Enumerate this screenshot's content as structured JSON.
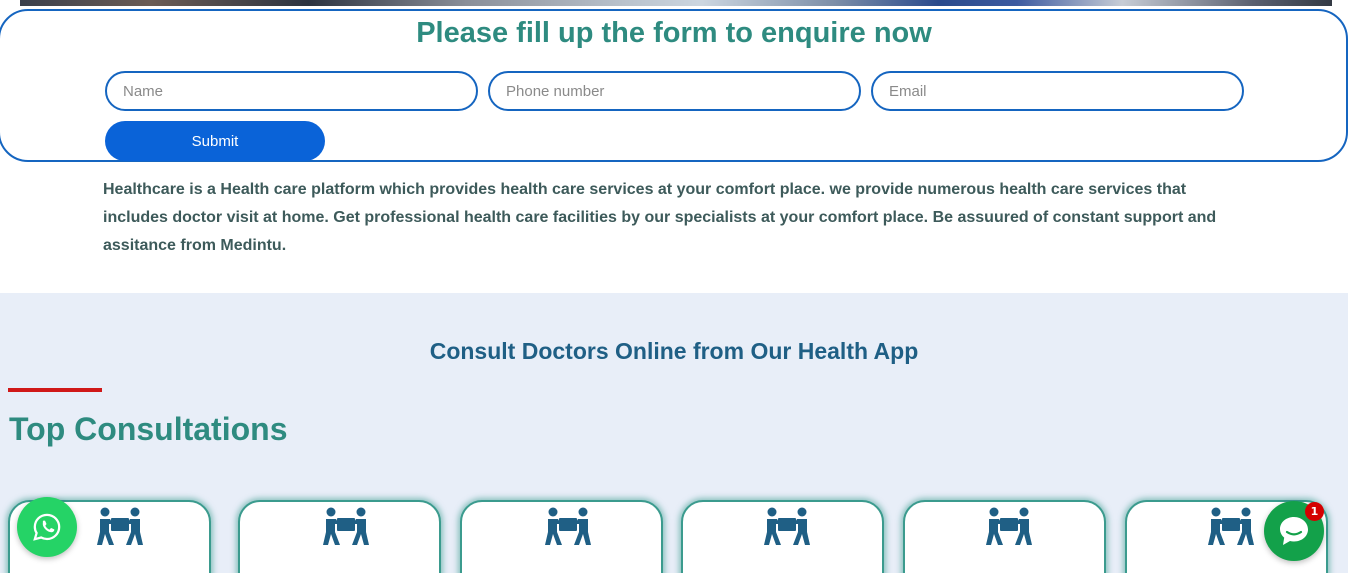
{
  "enquiry": {
    "title": "Please fill up the form to enquire now",
    "name_placeholder": "Name",
    "phone_placeholder": "Phone number",
    "email_placeholder": "Email",
    "submit_label": "Submit"
  },
  "about": {
    "text": "Healthcare is a Health care platform which provides health care services at your comfort place. we provide numerous health care services that  includes doctor visit at home. Get professional health care facilities by our specialists at your comfort place. Be assuured of constant support and assitance from Medintu."
  },
  "consult": {
    "heading": "Consult Doctors Online from Our Health App",
    "section_title": "Top Consultations",
    "card_icon": "people-carrying-box-icon",
    "card_count": 6
  },
  "widgets": {
    "whatsapp_icon": "whatsapp-icon",
    "chat_icon": "chat-bubble-icon",
    "chat_badge": "1"
  },
  "colors": {
    "teal": "#2e8b80",
    "navy": "#1f5f85",
    "blue": "#0a63d8",
    "red": "#d01818",
    "whatsapp_green": "#25d366",
    "chat_green": "#13a14a"
  }
}
